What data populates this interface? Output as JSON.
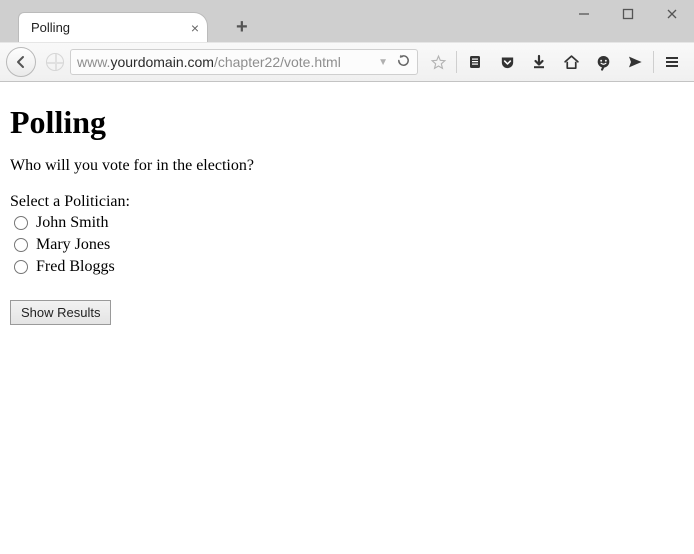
{
  "window": {
    "tab_title": "Polling",
    "url_prefix": "www.",
    "url_domain": "yourdomain.com",
    "url_path": "/chapter22/vote.html"
  },
  "page": {
    "heading": "Polling",
    "question": "Who will you vote for in the election?",
    "group_label": "Select a Politician:",
    "options": [
      {
        "label": "John Smith"
      },
      {
        "label": "Mary Jones"
      },
      {
        "label": "Fred Bloggs"
      }
    ],
    "submit_label": "Show Results"
  }
}
